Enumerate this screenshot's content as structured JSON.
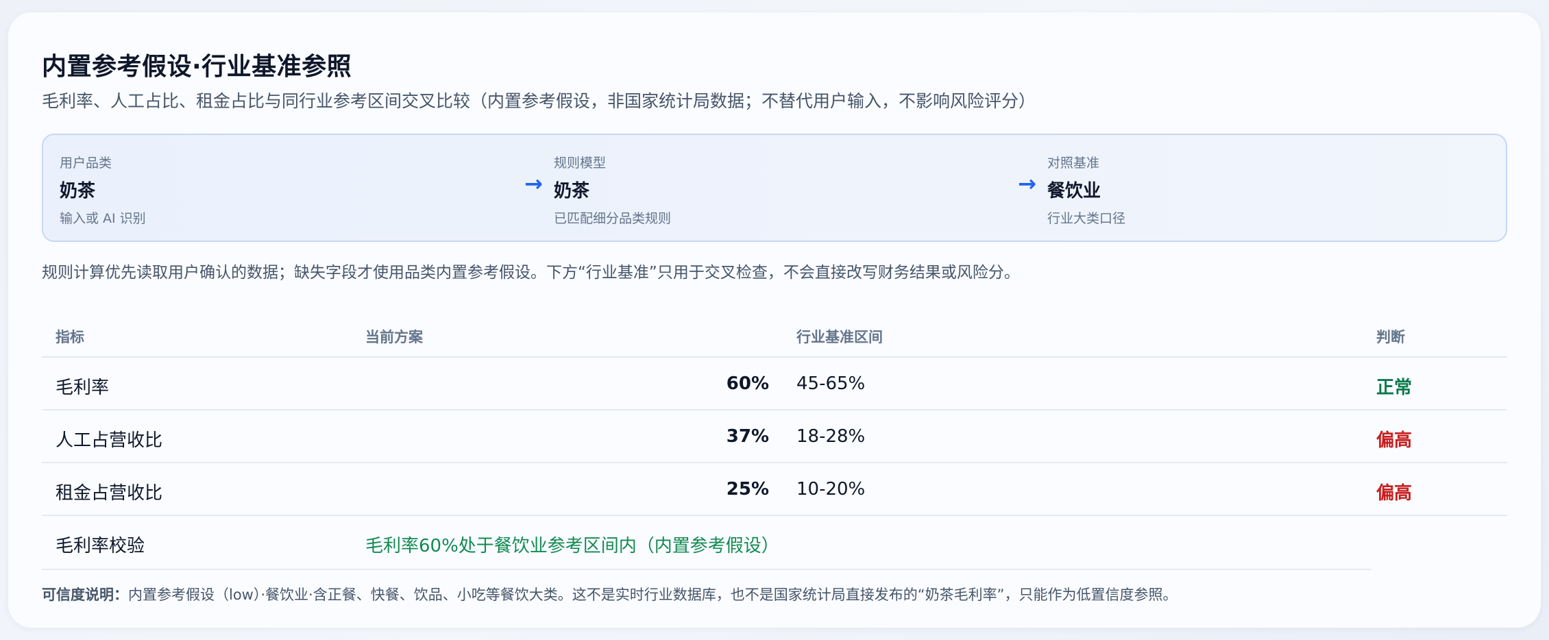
{
  "header": {
    "title": "内置参考假设·行业基准参照",
    "subtitle": "毛利率、人工占比、租金占比与同行业参考区间交叉比较（内置参考假设，非国家统计局数据；不替代用户输入，不影响风险评分）"
  },
  "flow": {
    "steps": [
      {
        "label": "用户品类",
        "value": "奶茶",
        "hint": "输入或 AI 识别"
      },
      {
        "label": "规则模型",
        "value": "奶茶",
        "hint": "已匹配细分品类规则"
      },
      {
        "label": "对照基准",
        "value": "餐饮业",
        "hint": "行业大类口径"
      }
    ],
    "arrow": "→"
  },
  "note": "规则计算优先读取用户确认的数据；缺失字段才使用品类内置参考假设。下方“行业基准”只用于交叉检查，不会直接改写财务结果或风险分。",
  "table": {
    "headers": [
      "指标",
      "当前方案",
      "行业基准区间",
      "判断"
    ],
    "rows": [
      {
        "metric": "毛利率",
        "value": "60%",
        "range": "45-65%",
        "judge": "正常",
        "status": "ok"
      },
      {
        "metric": "人工占营收比",
        "value": "37%",
        "range": "18-28%",
        "judge": "偏高",
        "status": "high"
      },
      {
        "metric": "租金占营收比",
        "value": "25%",
        "range": "10-20%",
        "judge": "偏高",
        "status": "high"
      }
    ],
    "check": {
      "metric": "毛利率校验",
      "text": "毛利率60%处于餐饮业参考区间内（内置参考假设）"
    }
  },
  "footer": {
    "label": "可信度说明：",
    "text": "内置参考假设（low）·餐饮业·含正餐、快餐、饮品、小吃等餐饮大类。这不是实时行业数据库，也不是国家统计局直接发布的“奶茶毛利率”，只能作为低置信度参照。"
  },
  "colors": {
    "accent": "#2563eb",
    "ok": "#0a7a4a",
    "high": "#c81e1e",
    "check": "#118a52"
  }
}
